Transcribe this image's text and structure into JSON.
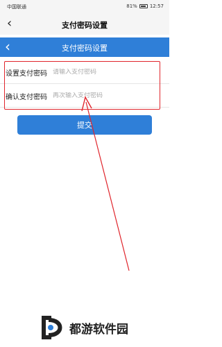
{
  "status_bar": {
    "carrier": "中国联通",
    "battery": "81%",
    "time": "12:57"
  },
  "header": {
    "title": "支付密码设置"
  },
  "blue_header": {
    "title": "支付密码设置"
  },
  "form": {
    "set_label": "设置支付密码",
    "set_placeholder": "请输入支付密码",
    "confirm_label": "确认支付密码",
    "confirm_placeholder": "再次输入支付密码"
  },
  "submit_label": "提交",
  "watermark": {
    "text": "都游软件园"
  },
  "colors": {
    "accent": "#2f7fd8",
    "annotation": "#e0242b"
  }
}
